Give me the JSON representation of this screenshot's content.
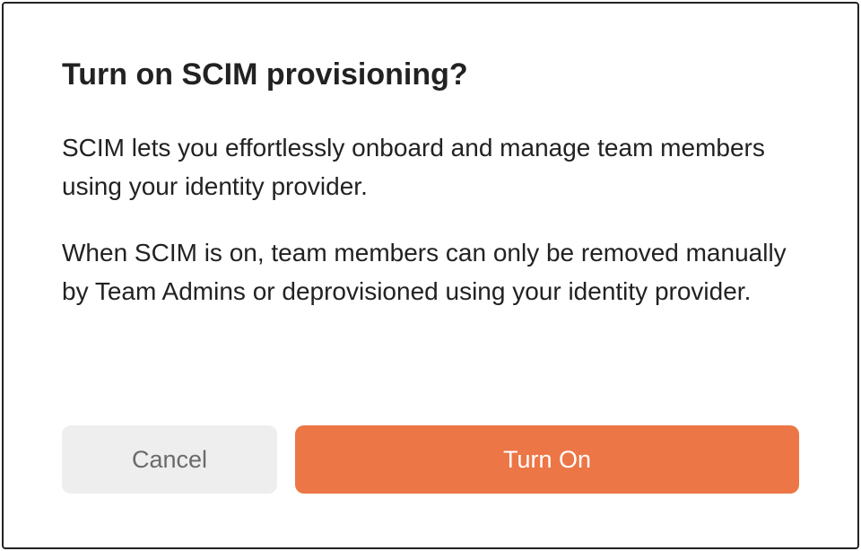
{
  "dialog": {
    "title": "Turn on SCIM provisioning?",
    "paragraph1": "SCIM lets you effortlessly onboard and manage team members using your identity provider.",
    "paragraph2": "When SCIM is on, team members can only be removed manually by Team Admins or deprovisioned using your identity provider.",
    "cancel_label": "Cancel",
    "confirm_label": "Turn On"
  }
}
